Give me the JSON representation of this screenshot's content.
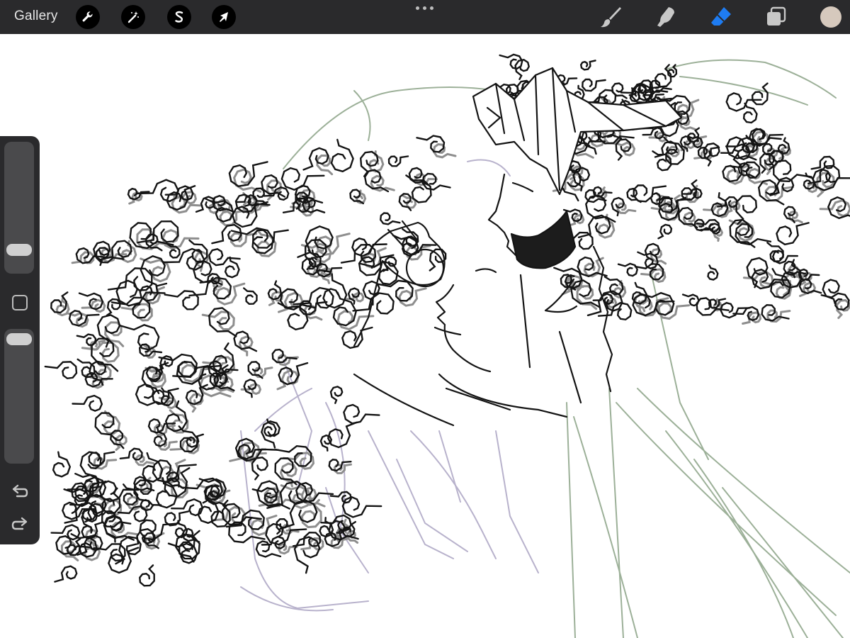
{
  "toolbar": {
    "gallery_label": "Gallery",
    "left_tools": [
      {
        "name": "actions",
        "icon": "wrench-icon"
      },
      {
        "name": "adjustments",
        "icon": "magic-wand-icon"
      },
      {
        "name": "selection",
        "icon": "selection-s-icon"
      },
      {
        "name": "transform",
        "icon": "arrow-cursor-icon"
      }
    ],
    "right_tools": [
      {
        "name": "brush",
        "icon": "brush-icon",
        "active": false
      },
      {
        "name": "smudge",
        "icon": "smudge-icon",
        "active": false
      },
      {
        "name": "eraser",
        "icon": "eraser-icon",
        "active": true
      },
      {
        "name": "layers",
        "icon": "layers-icon",
        "active": false
      }
    ],
    "active_tool": "eraser",
    "current_color": "#d6c9bd"
  },
  "sidebar": {
    "brush_size_level": 0.12,
    "brush_opacity_level": 1.0,
    "modify_button_icon": "square-icon",
    "undo_icon": "undo-icon",
    "redo_icon": "redo-icon"
  },
  "colors": {
    "toolbar_bg": "#2a2a2c",
    "active_accent": "#1e7cf2",
    "icon_inactive": "#c8c8c8",
    "ink": "#141414",
    "sketch_green": "#9cb098",
    "sketch_lavender": "#b8b2cc"
  },
  "canvas": {
    "subject_icon": "line-art-drawing"
  }
}
